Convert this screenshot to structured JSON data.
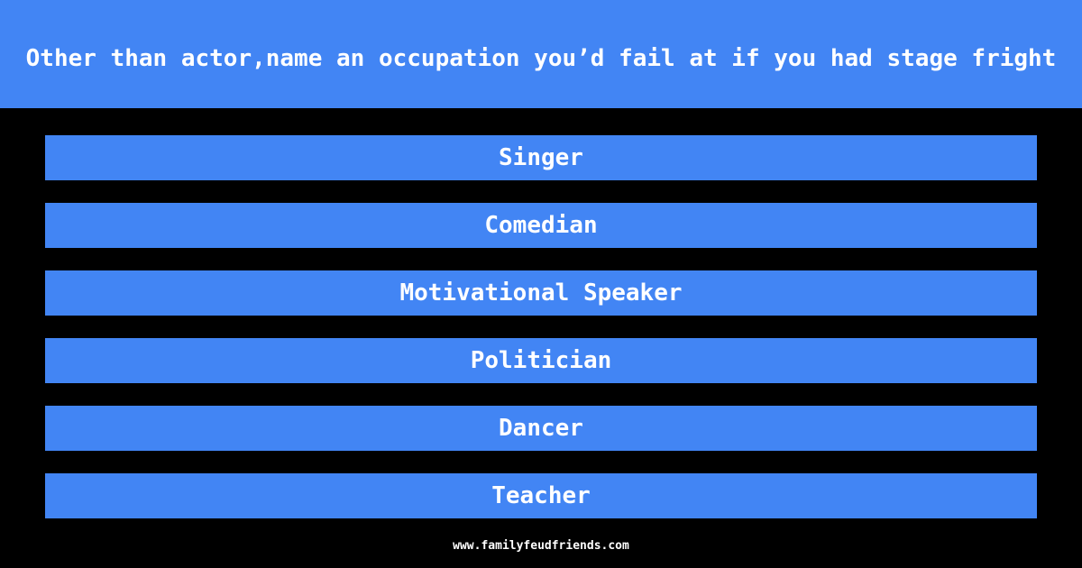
{
  "question": {
    "text": "Other than actor,name an occupation you’d fail at if you had stage fright"
  },
  "answers": [
    {
      "label": "Singer"
    },
    {
      "label": "Comedian"
    },
    {
      "label": "Motivational Speaker"
    },
    {
      "label": "Politician"
    },
    {
      "label": "Dancer"
    },
    {
      "label": "Teacher"
    }
  ],
  "footer": {
    "site": "www.familyfeudfriends.com"
  },
  "colors": {
    "accent": "#4285F4",
    "background": "#000000",
    "text": "#FFFFFF"
  }
}
